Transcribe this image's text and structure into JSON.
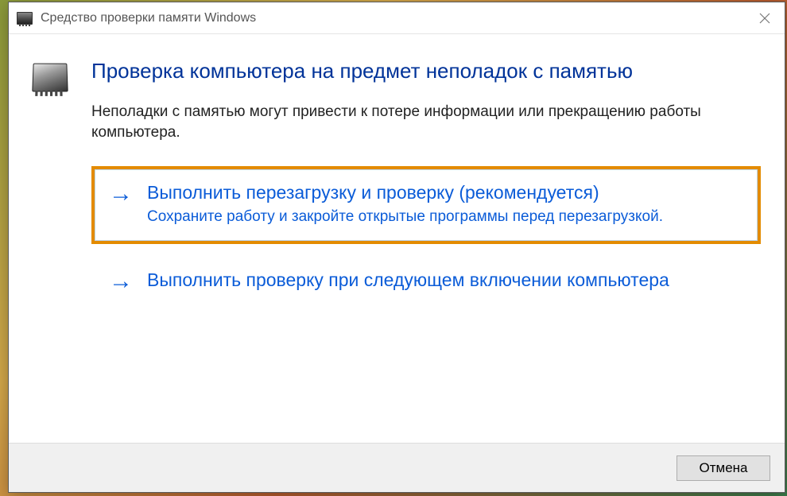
{
  "window": {
    "title": "Средство проверки памяти Windows"
  },
  "main": {
    "heading": "Проверка компьютера на предмет неполадок с памятью",
    "description": "Неполадки с памятью могут привести к потере информации или прекращению работы компьютера."
  },
  "options": [
    {
      "title": "Выполнить перезагрузку и проверку (рекомендуется)",
      "desc": "Сохраните работу и закройте открытые программы перед перезагрузкой."
    },
    {
      "title": "Выполнить проверку при следующем включении компьютера",
      "desc": ""
    }
  ],
  "footer": {
    "cancel": "Отмена"
  }
}
